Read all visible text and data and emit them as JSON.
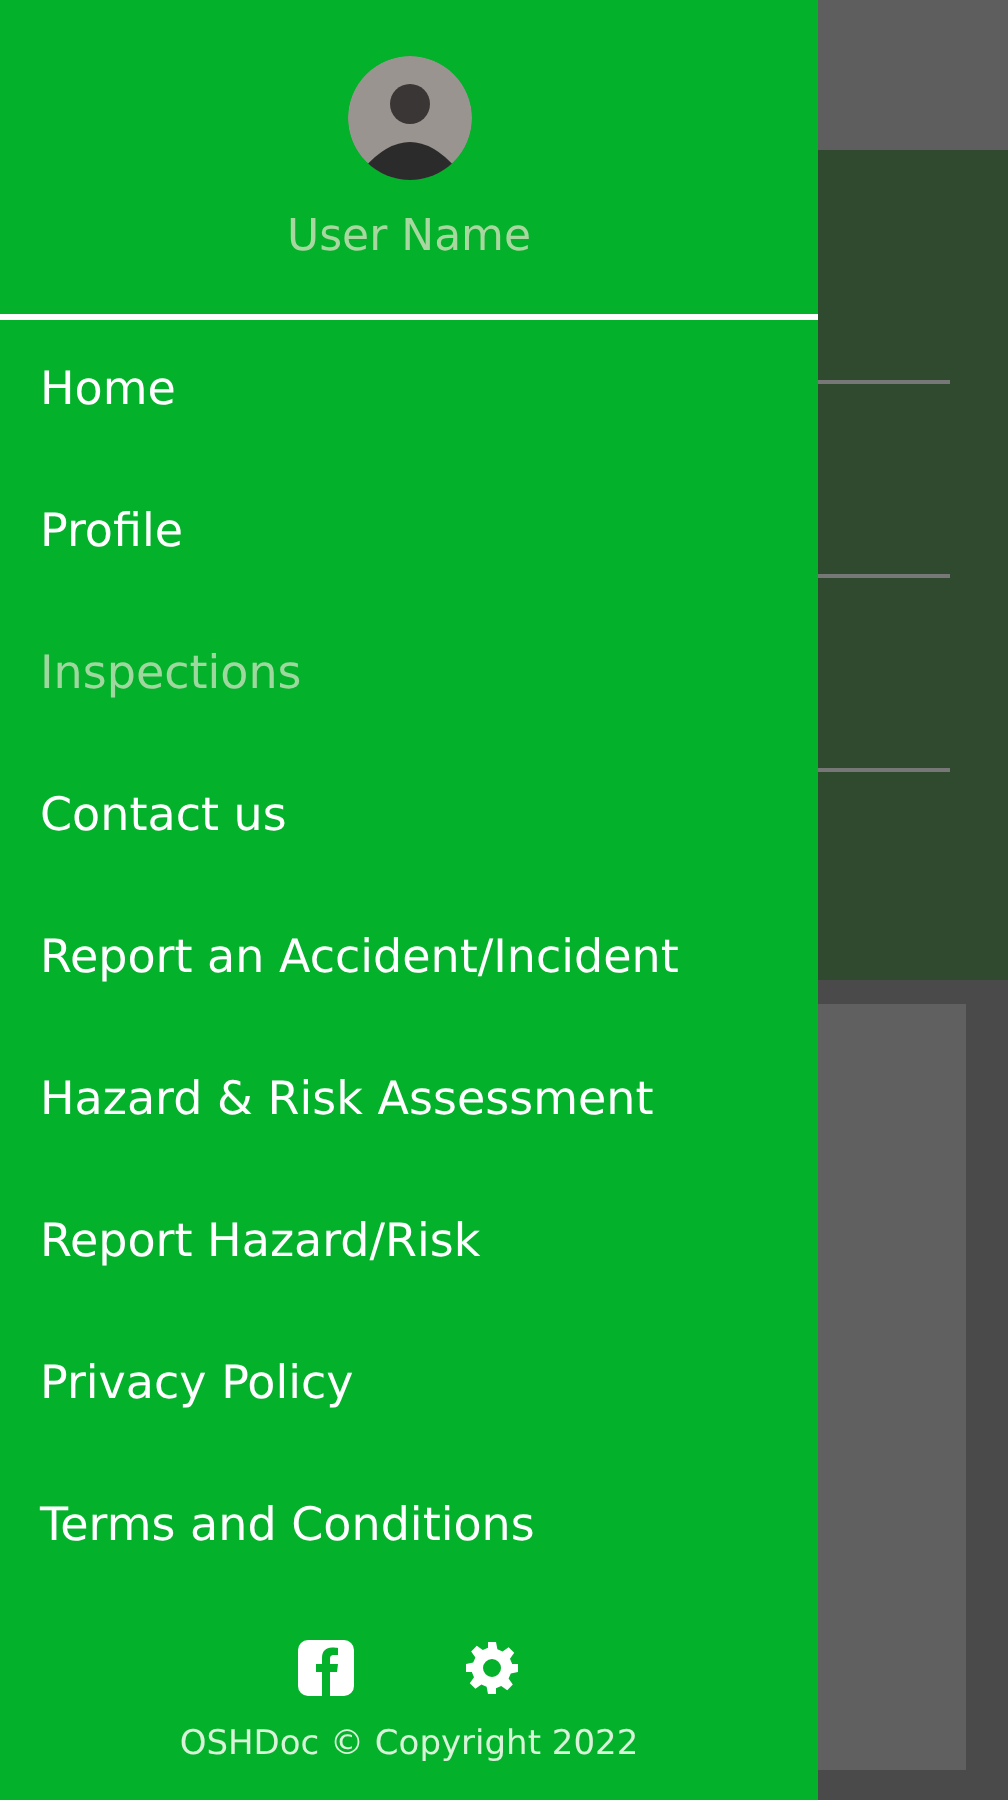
{
  "drawer": {
    "user_name": "User Name",
    "items": [
      {
        "label": "Home",
        "selected": false
      },
      {
        "label": "Profile",
        "selected": false
      },
      {
        "label": "Inspections",
        "selected": true
      },
      {
        "label": "Contact us",
        "selected": false
      },
      {
        "label": "Report an Accident/Incident",
        "selected": false
      },
      {
        "label": "Hazard & Risk Assessment",
        "selected": false
      },
      {
        "label": "Report Hazard/Risk",
        "selected": false
      },
      {
        "label": "Privacy Policy",
        "selected": false
      },
      {
        "label": "Terms and Conditions",
        "selected": false
      }
    ],
    "footer": {
      "copyright": "OSHDoc © Copyright 2022"
    }
  }
}
